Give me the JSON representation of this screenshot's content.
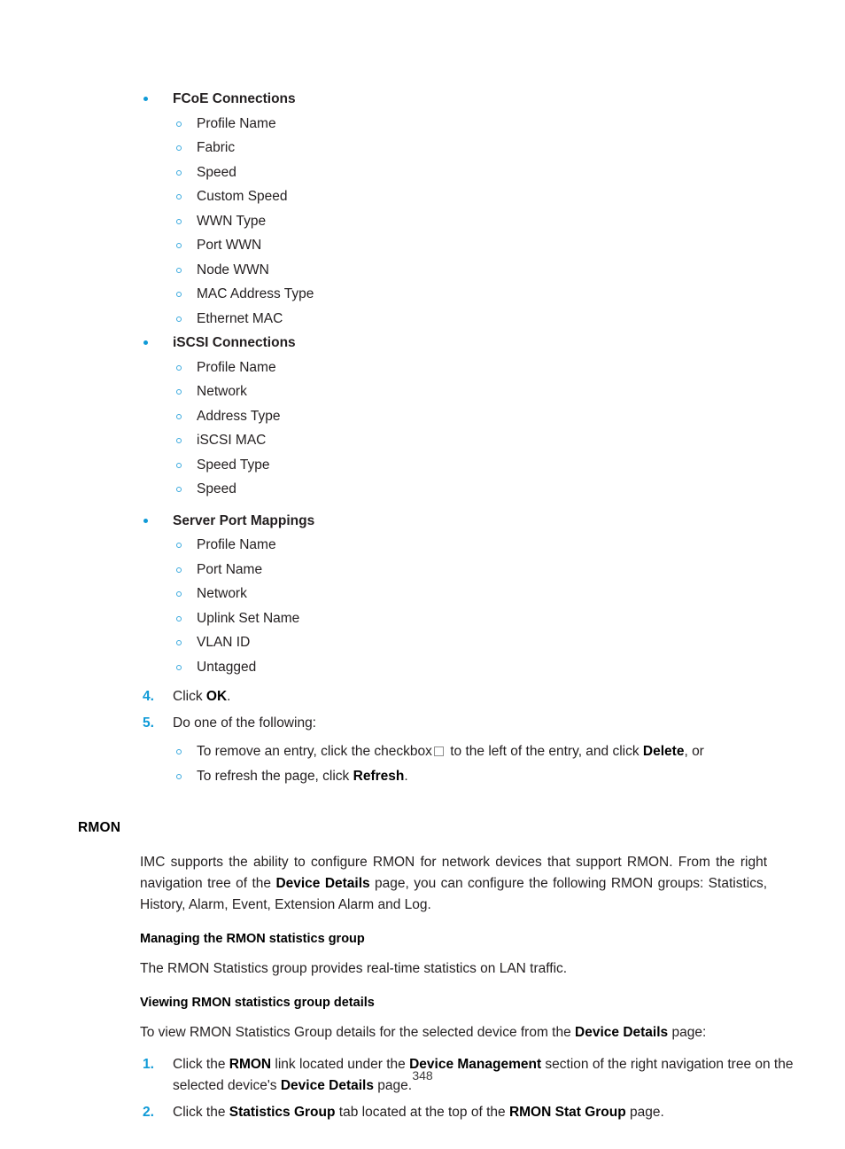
{
  "page": {
    "number": "348"
  },
  "fields_lists": [
    {
      "heading": "FCoE Connections",
      "items": [
        "Profile Name",
        "Fabric",
        "Speed",
        "Custom Speed",
        "WWN Type",
        "Port WWN",
        "Node WWN",
        "MAC Address Type",
        "Ethernet MAC"
      ]
    },
    {
      "heading": "iSCSI Connections",
      "items": [
        "Profile Name",
        "Network",
        "Address Type",
        "iSCSI MAC",
        "Speed Type",
        "Speed"
      ]
    },
    {
      "heading": "Server Port Mappings",
      "items": [
        "Profile Name",
        "Port Name",
        "Network",
        "Uplink Set Name",
        "VLAN ID",
        "Untagged"
      ]
    }
  ],
  "steps_upper": {
    "step4": {
      "number": "4.",
      "text_before": "Click ",
      "bold": "OK",
      "text_after": "."
    },
    "step5": {
      "number": "5.",
      "text": "Do one of the following:",
      "substeps": [
        {
          "part1": "To remove an entry, click the checkbox",
          "icon": "checkbox-icon",
          "part2": " to the left of the entry, and click ",
          "bold": "Delete",
          "part3": ", or"
        },
        {
          "part1": "To refresh the page, click ",
          "bold": "Refresh",
          "part2": "."
        }
      ]
    }
  },
  "rmon": {
    "title": "RMON",
    "intro": {
      "part1": "IMC supports the ability to configure RMON for network devices that support RMON. From the right navigation tree of the ",
      "bold1": "Device Details",
      "part2": " page, you can configure the following RMON groups: Statistics, History, Alarm, Event, Extension Alarm and Log."
    },
    "subsection1": {
      "heading": "Managing the RMON statistics group",
      "paragraph": "The RMON Statistics group provides real-time statistics on LAN traffic."
    },
    "subsection2": {
      "heading": "Viewing RMON statistics group details",
      "lead": {
        "part1": "To view RMON Statistics Group details for the selected device from the ",
        "bold1": "Device Details",
        "part2": " page:"
      },
      "steps": [
        {
          "number": "1.",
          "part1": "Click the ",
          "bold1": "RMON",
          "part2": " link located under the ",
          "bold2": "Device Management",
          "part3": " section of the right navigation tree on the selected device's ",
          "bold3": "Device Details",
          "part4": " page."
        },
        {
          "number": "2.",
          "part1": "Click the ",
          "bold1": "Statistics Group",
          "part2": " tab located at the top of the ",
          "bold2": "RMON Stat Group",
          "part3": " page."
        }
      ]
    }
  },
  "colors": {
    "accent_blue": "#0f9ad7",
    "ring_blue": "#3aa9de",
    "text": "#231f20"
  }
}
